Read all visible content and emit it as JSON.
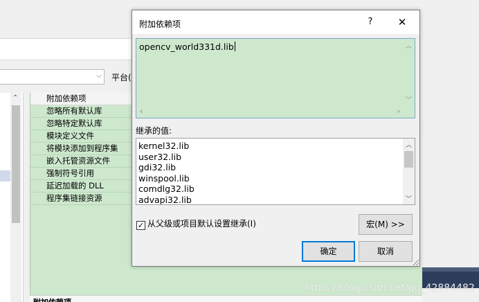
{
  "background": {
    "platform_label": "平台(I",
    "property_rows": [
      "附加依赖项",
      "忽略所有默认库",
      "忽略特定默认库",
      "模块定义文件",
      "将模块添加到程序集",
      "嵌入托管资源文件",
      "强制符号引用",
      "延迟加载的 DLL",
      "程序集链接资源"
    ],
    "description_title": "附加依赖项"
  },
  "dialog": {
    "title": "附加依赖项",
    "help_label": "?",
    "close_label": "✕",
    "edit_value": "opencv_world331d.lib",
    "inherited_label": "继承的值:",
    "inherited_values": [
      "kernel32.lib",
      "user32.lib",
      "gdi32.lib",
      "winspool.lib",
      "comdlg32.lib",
      "advapi32.lib"
    ],
    "inherit_checkbox_label": "从父级或项目默认设置继承(I)",
    "inherit_checked": true,
    "macro_button": "宏(M) >>",
    "ok_button": "确定",
    "cancel_button": "取消"
  },
  "watermark": "https://blog.csdn.net/qq_42884482",
  "colors": {
    "edit_bg": "#cde8cd",
    "accent": "#0078d7",
    "dark_panel": "#2d3d5c"
  },
  "icons": {
    "dropdown": "chevron-down-icon",
    "close": "close-icon",
    "help": "help-icon"
  }
}
